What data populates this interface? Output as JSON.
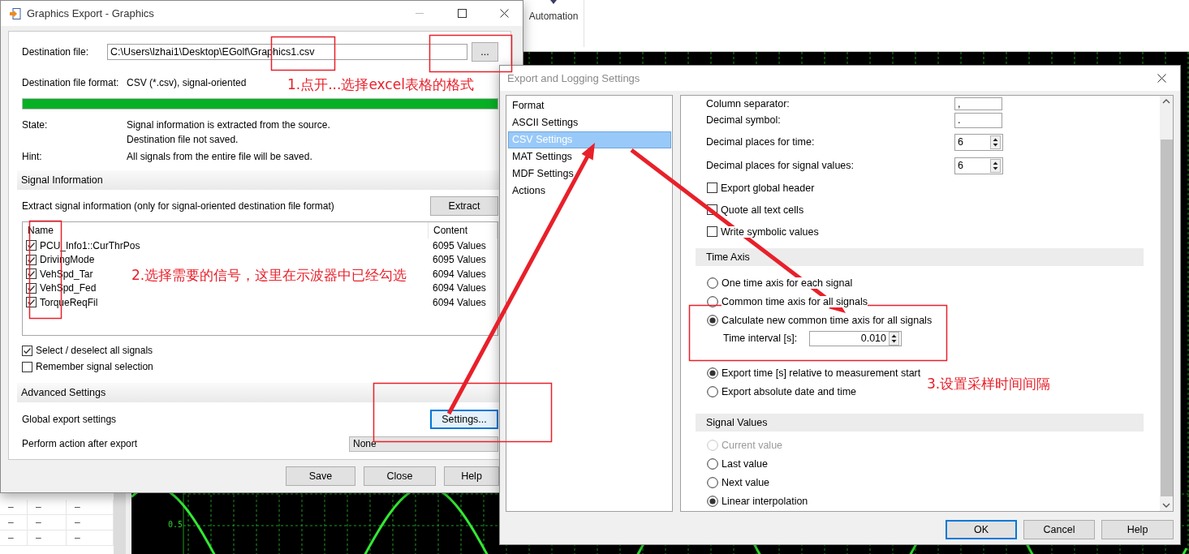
{
  "background": {
    "ribbon_label": "Automation",
    "scope_ticks": [
      "0.5"
    ],
    "table_rows": [
      [
        "–",
        "–",
        "–"
      ],
      [
        "–",
        "–",
        "–"
      ],
      [
        "–",
        "–",
        "–"
      ]
    ]
  },
  "export_dialog": {
    "title": "Graphics Export - Graphics",
    "destination_label": "Destination file:",
    "destination_value": "C:\\Users\\lzhai1\\Desktop\\EGolf\\Graphics1.csv",
    "browse_button": "...",
    "format_label": "Destination file format:",
    "format_value": "CSV (*.csv), signal-oriented",
    "progress": {
      "level": 1
    },
    "state_label": "State:",
    "state_lines": [
      "Signal information is extracted from the source.",
      "Destination file not saved."
    ],
    "hint_label": "Hint:",
    "hint_value": "All signals from the entire file will be saved.",
    "signal_information": {
      "title": "Signal Information",
      "extract_text": "Extract signal information (only for signal-oriented destination file format)",
      "extract_button": "Extract",
      "columns": [
        "Name",
        "Content"
      ],
      "signals": [
        {
          "name": "PCU_Info1::CurThrPos",
          "content": "6095 Values",
          "checked": true
        },
        {
          "name": "DrivingMode",
          "content": "6095 Values",
          "checked": true
        },
        {
          "name": "VehSpd_Tar",
          "content": "6094 Values",
          "checked": true
        },
        {
          "name": "VehSpd_Fed",
          "content": "6094 Values",
          "checked": true
        },
        {
          "name": "TorqueReqFil",
          "content": "6094 Values",
          "checked": true
        }
      ],
      "options": [
        {
          "label": "Select / deselect all signals",
          "checked": true
        },
        {
          "label": "Remember signal selection",
          "checked": false
        }
      ]
    },
    "advanced_settings": {
      "title": "Advanced Settings",
      "global_label": "Global export settings",
      "settings_button": "Settings...",
      "action_label": "Perform action after export",
      "action_value": "None"
    },
    "buttons": [
      "Save",
      "Close",
      "Help"
    ]
  },
  "settings_dialog": {
    "title": "Export and Logging Settings",
    "nav": [
      {
        "label": "Format",
        "selected": false
      },
      {
        "label": "ASCII Settings",
        "selected": false
      },
      {
        "label": "CSV Settings",
        "selected": true
      },
      {
        "label": "MAT Settings",
        "selected": false
      },
      {
        "label": "MDF Settings",
        "selected": false
      },
      {
        "label": "Actions",
        "selected": false
      }
    ],
    "fields": [
      {
        "kind": "text",
        "label": "Column separator:",
        "value": ","
      },
      {
        "kind": "text",
        "label": "Decimal symbol:",
        "value": "."
      },
      {
        "kind": "spin",
        "label": "Decimal places for time:",
        "value": "6"
      },
      {
        "kind": "spin",
        "label": "Decimal places for signal values:",
        "value": "6"
      }
    ],
    "checkboxes": [
      {
        "label": "Export global header",
        "checked": false
      },
      {
        "label": "Quote all text cells",
        "checked": false
      },
      {
        "label": "Write symbolic values",
        "checked": false
      }
    ],
    "time_axis": {
      "title": "Time Axis",
      "options": [
        {
          "label": "One time axis for each signal",
          "selected": false
        },
        {
          "label": "Common time axis for all signals",
          "selected": false
        },
        {
          "label": "Calculate new common time axis for all signals",
          "selected": true
        }
      ],
      "interval_label": "Time interval [s]:",
      "interval_value": "0.010",
      "time_format": [
        {
          "label": "Export time [s] relative to measurement start",
          "selected": true
        },
        {
          "label": "Export absolute date and time",
          "selected": false
        }
      ]
    },
    "signal_values": {
      "title": "Signal Values",
      "options": [
        {
          "label": "Current value",
          "selected": false,
          "disabled": true
        },
        {
          "label": "Last value",
          "selected": false,
          "disabled": false
        },
        {
          "label": "Next value",
          "selected": false,
          "disabled": false
        },
        {
          "label": "Linear interpolation",
          "selected": true,
          "disabled": false
        }
      ]
    },
    "buttons": [
      "OK",
      "Cancel",
      "Help"
    ]
  },
  "annotations": {
    "notes": [
      "1.点开...选择excel表格的格式",
      "2.选择需要的信号，这里在示波器中已经勾选",
      "3.设置采样时间间隔"
    ]
  }
}
